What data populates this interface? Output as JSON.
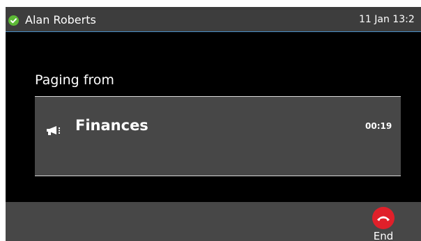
{
  "status_bar": {
    "user_name": "Alan Roberts",
    "datetime": "11 Jan 13:2",
    "presence_icon": "check-circle-icon",
    "presence_color": "#5cb836"
  },
  "paging": {
    "label": "Paging from",
    "group_name": "Finances",
    "timer": "00:19",
    "icon": "megaphone-icon"
  },
  "softkeys": {
    "end_label": "End",
    "end_icon": "hang-up-icon",
    "end_color": "#e0202a"
  }
}
